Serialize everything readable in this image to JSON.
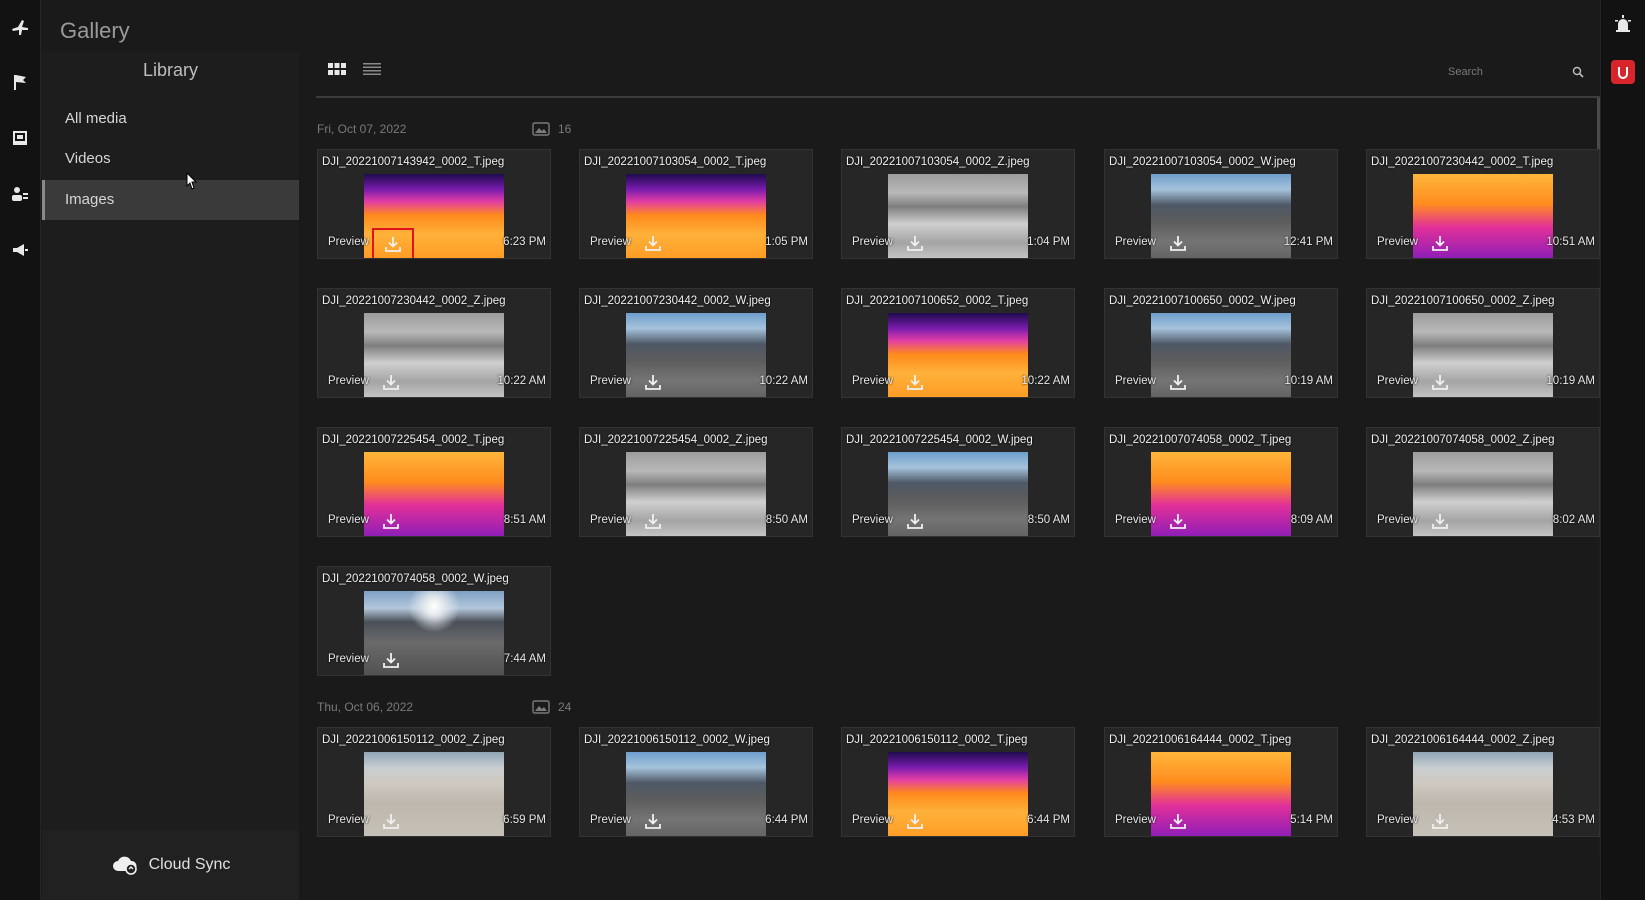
{
  "app": {
    "title": "Gallery"
  },
  "library": {
    "title": "Library",
    "items": [
      {
        "label": "All media"
      },
      {
        "label": "Videos"
      },
      {
        "label": "Images"
      }
    ]
  },
  "cloud_sync": {
    "label": "Cloud Sync"
  },
  "search": {
    "placeholder": "Search"
  },
  "preview_label": "Preview",
  "groups": [
    {
      "date": "Fri, Oct 07, 2022",
      "count": "16"
    },
    {
      "date": "Thu, Oct 06, 2022",
      "count": "24"
    }
  ],
  "items": [
    {
      "name": "DJI_20221007143942_0002_T.jpeg",
      "time": "6:23 PM"
    },
    {
      "name": "DJI_20221007103054_0002_T.jpeg",
      "time": "1:05 PM"
    },
    {
      "name": "DJI_20221007103054_0002_Z.jpeg",
      "time": "1:04 PM"
    },
    {
      "name": "DJI_20221007103054_0002_W.jpeg",
      "time": "12:41 PM"
    },
    {
      "name": "DJI_20221007230442_0002_T.jpeg",
      "time": "10:51 AM"
    },
    {
      "name": "DJI_20221007230442_0002_Z.jpeg",
      "time": "10:22 AM"
    },
    {
      "name": "DJI_20221007230442_0002_W.jpeg",
      "time": "10:22 AM"
    },
    {
      "name": "DJI_20221007100652_0002_T.jpeg",
      "time": "10:22 AM"
    },
    {
      "name": "DJI_20221007100650_0002_W.jpeg",
      "time": "10:19 AM"
    },
    {
      "name": "DJI_20221007100650_0002_Z.jpeg",
      "time": "10:19 AM"
    },
    {
      "name": "DJI_20221007225454_0002_T.jpeg",
      "time": "8:51 AM"
    },
    {
      "name": "DJI_20221007225454_0002_Z.jpeg",
      "time": "8:50 AM"
    },
    {
      "name": "DJI_20221007225454_0002_W.jpeg",
      "time": "8:50 AM"
    },
    {
      "name": "DJI_20221007074058_0002_T.jpeg",
      "time": "8:09 AM"
    },
    {
      "name": "DJI_20221007074058_0002_Z.jpeg",
      "time": "8:02 AM"
    },
    {
      "name": "DJI_20221007074058_0002_W.jpeg",
      "time": "7:44 AM"
    },
    {
      "name": "DJI_20221006150112_0002_Z.jpeg",
      "time": "6:59 PM"
    },
    {
      "name": "DJI_20221006150112_0002_W.jpeg",
      "time": "6:44 PM"
    },
    {
      "name": "DJI_20221006150112_0002_T.jpeg",
      "time": "6:44 PM"
    },
    {
      "name": "DJI_20221006164444_0002_T.jpeg",
      "time": "5:14 PM"
    },
    {
      "name": "DJI_20221006164444_0002_Z.jpeg",
      "time": "4:53 PM"
    }
  ]
}
